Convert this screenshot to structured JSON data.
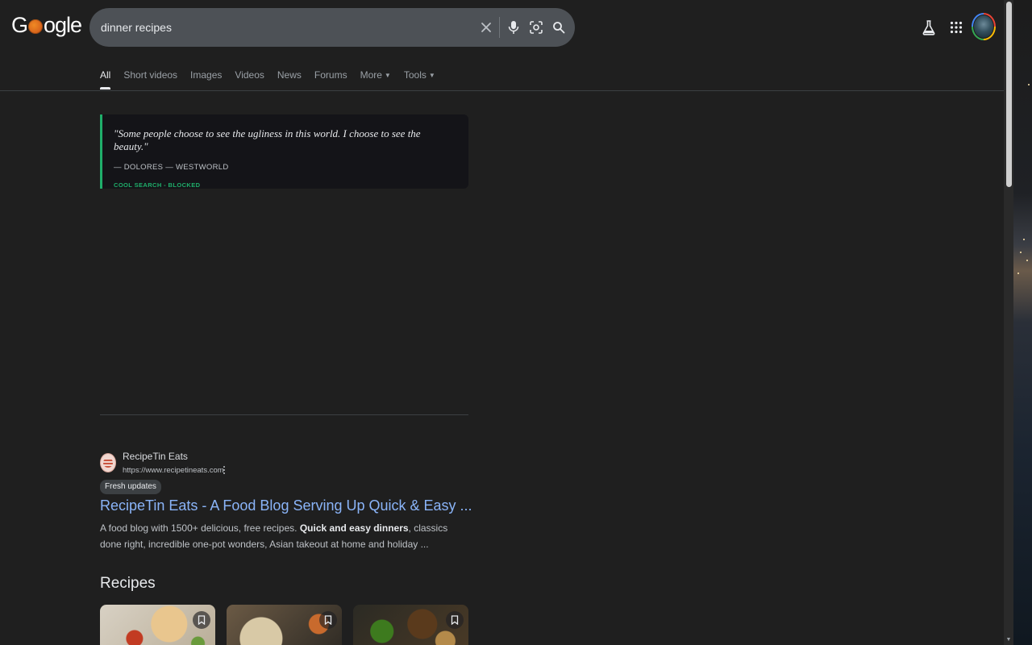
{
  "header": {
    "logo_left": "G",
    "logo_right": "ogle",
    "search": {
      "value": "dinner recipes"
    }
  },
  "tabs": [
    {
      "label": "All",
      "active": true
    },
    {
      "label": "Short videos"
    },
    {
      "label": "Images"
    },
    {
      "label": "Videos"
    },
    {
      "label": "News"
    },
    {
      "label": "Forums"
    },
    {
      "label": "More",
      "dropdown": true
    },
    {
      "label": "Tools",
      "dropdown": true
    }
  ],
  "quote_card": {
    "quote": "\"Some people choose to see the ugliness in this world. I choose to see the beauty.\"",
    "attribution": "— DOLORES — WESTWORLD",
    "status": "COOL SEARCH - BLOCKED",
    "accent_color": "#1fae6a"
  },
  "result": {
    "site_name": "RecipeTin Eats",
    "url": "https://www.recipetineats.com",
    "badge": "Fresh updates",
    "title": "RecipeTin Eats - A Food Blog Serving Up Quick & Easy ...",
    "snippet_pre": "A food blog with 1500+ delicious, free recipes. ",
    "snippet_bold": "Quick and easy dinners",
    "snippet_post": ", classics done right, incredible one-pot wonders, Asian takeout at home and holiday ...",
    "title_color": "#8ab4f8"
  },
  "recipes_section": {
    "heading": "Recipes"
  },
  "icons": {
    "clear": "close-icon",
    "voice": "microphone-icon",
    "lens": "camera-lens-icon",
    "search": "search-icon",
    "labs": "flask-icon",
    "apps": "apps-grid-icon",
    "save": "bookmark-icon"
  }
}
